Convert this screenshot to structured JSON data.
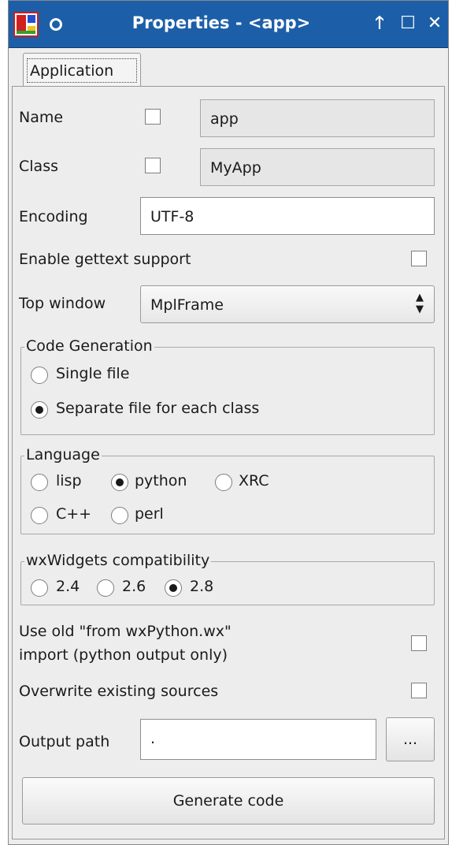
{
  "window": {
    "title": "Properties - <app>",
    "buttons": {
      "up": "🡑",
      "max": "☐",
      "close": "✕"
    }
  },
  "tabs": [
    {
      "label": "Application"
    }
  ],
  "form": {
    "name": {
      "label": "Name",
      "value": "app",
      "checked": false
    },
    "class": {
      "label": "Class",
      "value": "MyApp",
      "checked": false
    },
    "encoding": {
      "label": "Encoding",
      "value": "UTF-8"
    },
    "gettext": {
      "label": "Enable gettext support",
      "checked": false
    },
    "top_window": {
      "label": "Top window",
      "value": "MplFrame"
    },
    "code_generation": {
      "title": "Code Generation",
      "options": [
        "Single file",
        "Separate file for each class"
      ],
      "selected": "Separate file for each class"
    },
    "language": {
      "title": "Language",
      "options": [
        "lisp",
        "python",
        "XRC",
        "C++",
        "perl"
      ],
      "selected": "python"
    },
    "wx_compat": {
      "title": "wxWidgets compatibility",
      "options": [
        "2.4",
        "2.6",
        "2.8"
      ],
      "selected": "2.8"
    },
    "old_import": {
      "label_line1": "Use old \"from wxPython.wx\"",
      "label_line2": "import (python output only)",
      "checked": false
    },
    "overwrite": {
      "label": "Overwrite existing sources",
      "checked": false
    },
    "output_path": {
      "label": "Output path",
      "value": ".",
      "browse_label": "..."
    },
    "generate_label": "Generate code"
  }
}
